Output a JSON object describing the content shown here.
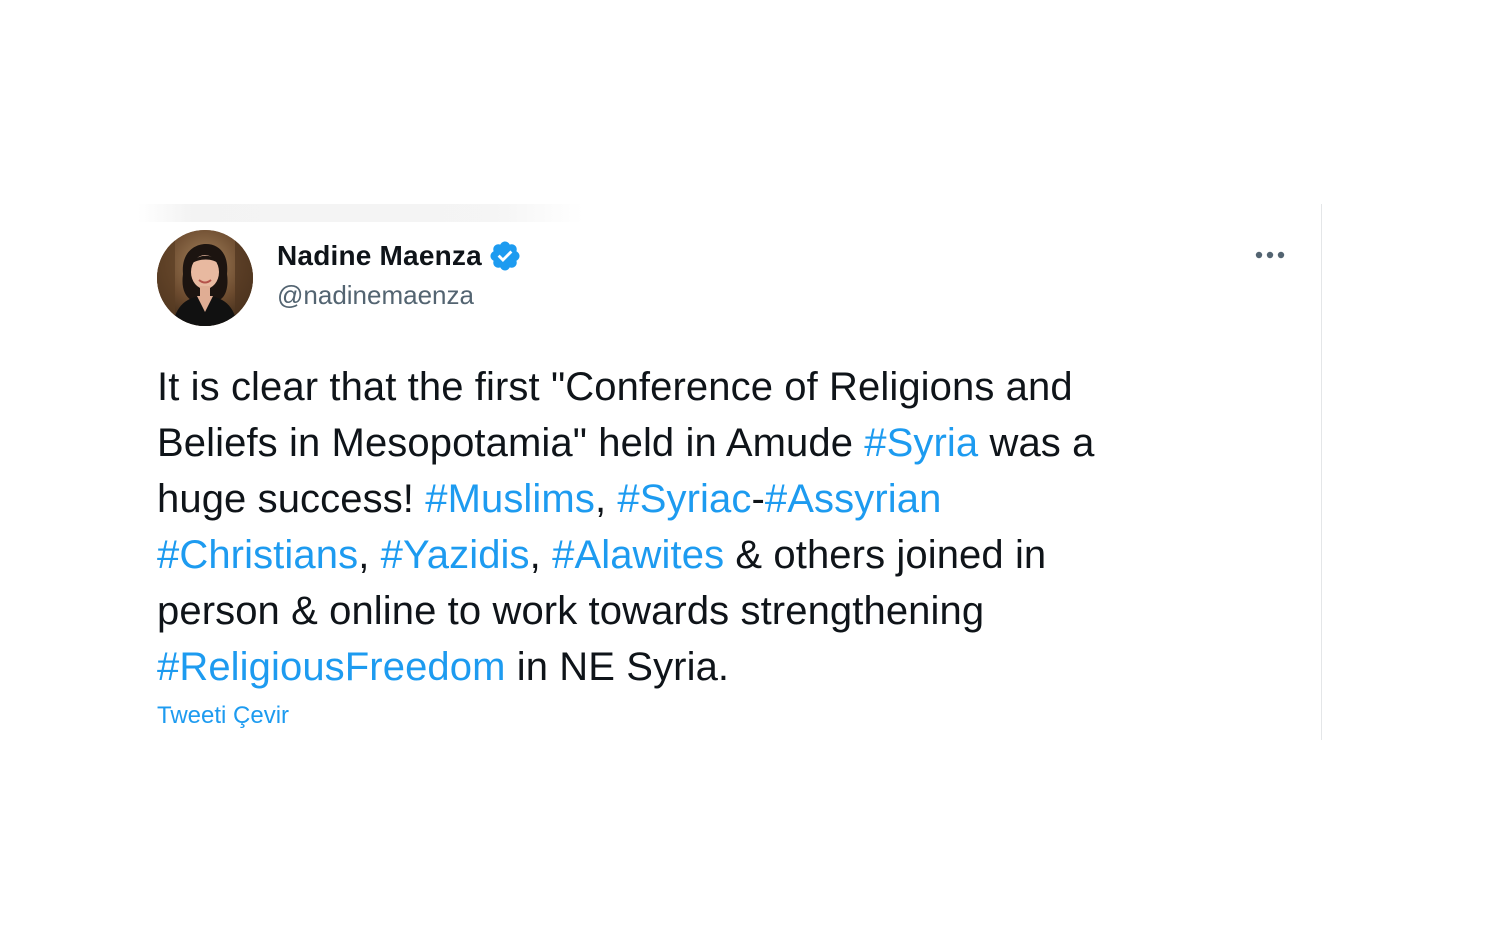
{
  "author": {
    "display_name": "Nadine Maenza",
    "handle": "@nadinemaenza",
    "verified": true,
    "avatar_icon": "profile-photo"
  },
  "menu": {
    "icon": "more-horizontal-icon"
  },
  "tweet": {
    "lines": [
      [
        {
          "text": "It is clear that the first \"Conference of Religions and",
          "type": "text"
        }
      ],
      [
        {
          "text": "Beliefs in Mesopotamia\" held in Amude ",
          "type": "text"
        },
        {
          "text": "#Syria",
          "type": "hashtag"
        },
        {
          "text": " was a",
          "type": "text"
        }
      ],
      [
        {
          "text": "huge success! ",
          "type": "text"
        },
        {
          "text": "#Muslims",
          "type": "hashtag"
        },
        {
          "text": ", ",
          "type": "text"
        },
        {
          "text": "#Syriac",
          "type": "hashtag"
        },
        {
          "text": "-",
          "type": "text"
        },
        {
          "text": "#Assyrian",
          "type": "hashtag"
        }
      ],
      [
        {
          "text": "#Christians",
          "type": "hashtag"
        },
        {
          "text": ", ",
          "type": "text"
        },
        {
          "text": "#Yazidis",
          "type": "hashtag"
        },
        {
          "text": ", ",
          "type": "text"
        },
        {
          "text": "#Alawites",
          "type": "hashtag"
        },
        {
          "text": " & others joined in",
          "type": "text"
        }
      ],
      [
        {
          "text": "person & online to work towards strengthening",
          "type": "text"
        }
      ],
      [
        {
          "text": "#ReligiousFreedom",
          "type": "hashtag"
        },
        {
          "text": " in NE Syria.",
          "type": "text"
        }
      ]
    ],
    "translate_label": "Tweeti Çevir"
  },
  "colors": {
    "link": "#1d9bf0",
    "text": "#0f1419",
    "secondary": "#536471",
    "verified": "#1d9bf0"
  }
}
